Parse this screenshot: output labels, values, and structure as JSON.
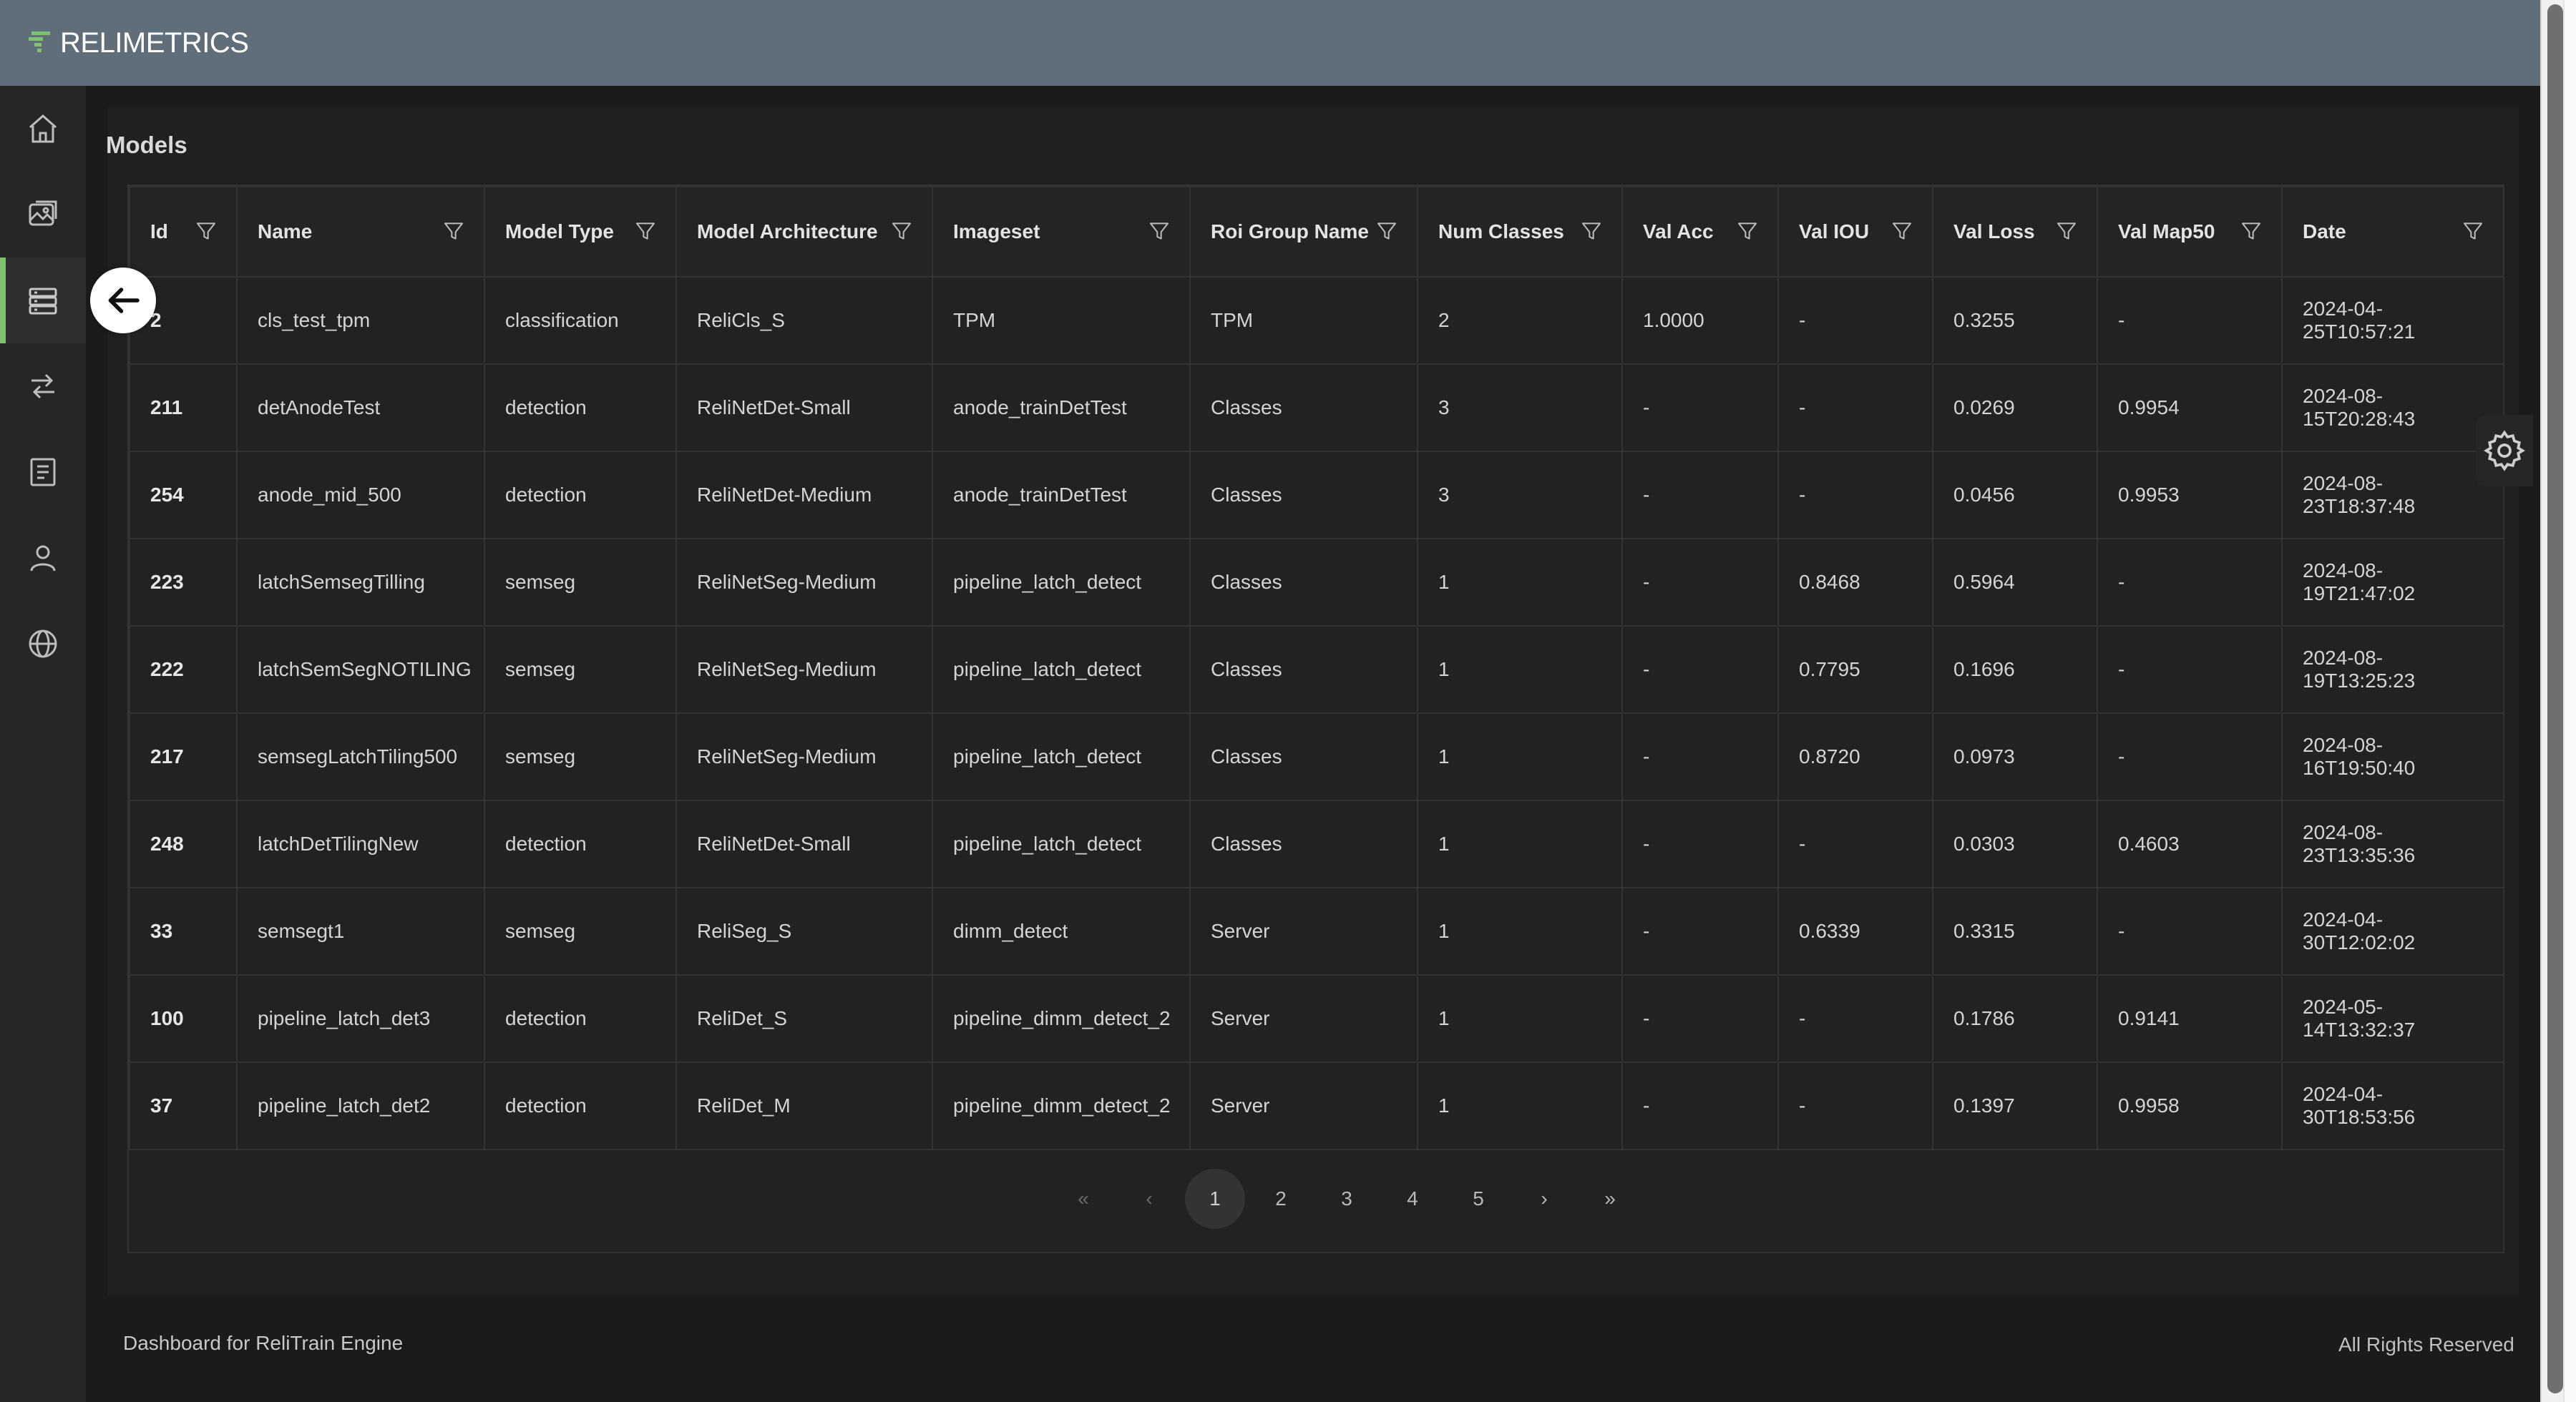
{
  "app": {
    "brand": "RELIMETRICS"
  },
  "page": {
    "title": "Models"
  },
  "nav": [
    {
      "icon": "home-icon"
    },
    {
      "icon": "images-icon"
    },
    {
      "icon": "models-icon"
    },
    {
      "icon": "transfer-icon"
    },
    {
      "icon": "document-icon"
    },
    {
      "icon": "user-icon"
    },
    {
      "icon": "globe-icon"
    }
  ],
  "table": {
    "columns": [
      "Id",
      "Name",
      "Model Type",
      "Model Architecture",
      "Imageset",
      "Roi Group Name",
      "Num Classes",
      "Val Acc",
      "Val IOU",
      "Val Loss",
      "Val Map50",
      "Date"
    ],
    "rows": [
      [
        "2",
        "cls_test_tpm",
        "classification",
        "ReliCls_S",
        "TPM",
        "TPM",
        "2",
        "1.0000",
        "-",
        "0.3255",
        "-",
        "2024-04-25T10:57:21"
      ],
      [
        "211",
        "detAnodeTest",
        "detection",
        "ReliNetDet-Small",
        "anode_trainDetTest",
        "Classes",
        "3",
        "-",
        "-",
        "0.0269",
        "0.9954",
        "2024-08-15T20:28:43"
      ],
      [
        "254",
        "anode_mid_500",
        "detection",
        "ReliNetDet-Medium",
        "anode_trainDetTest",
        "Classes",
        "3",
        "-",
        "-",
        "0.0456",
        "0.9953",
        "2024-08-23T18:37:48"
      ],
      [
        "223",
        "latchSemsegTilling",
        "semseg",
        "ReliNetSeg-Medium",
        "pipeline_latch_detect",
        "Classes",
        "1",
        "-",
        "0.8468",
        "0.5964",
        "-",
        "2024-08-19T21:47:02"
      ],
      [
        "222",
        "latchSemSegNOTILING",
        "semseg",
        "ReliNetSeg-Medium",
        "pipeline_latch_detect",
        "Classes",
        "1",
        "-",
        "0.7795",
        "0.1696",
        "-",
        "2024-08-19T13:25:23"
      ],
      [
        "217",
        "semsegLatchTiling500",
        "semseg",
        "ReliNetSeg-Medium",
        "pipeline_latch_detect",
        "Classes",
        "1",
        "-",
        "0.8720",
        "0.0973",
        "-",
        "2024-08-16T19:50:40"
      ],
      [
        "248",
        "latchDetTilingNew",
        "detection",
        "ReliNetDet-Small",
        "pipeline_latch_detect",
        "Classes",
        "1",
        "-",
        "-",
        "0.0303",
        "0.4603",
        "2024-08-23T13:35:36"
      ],
      [
        "33",
        "semsegt1",
        "semseg",
        "ReliSeg_S",
        "dimm_detect",
        "Server",
        "1",
        "-",
        "0.6339",
        "0.3315",
        "-",
        "2024-04-30T12:02:02"
      ],
      [
        "100",
        "pipeline_latch_det3",
        "detection",
        "ReliDet_S",
        "pipeline_dimm_detect_2",
        "Server",
        "1",
        "-",
        "-",
        "0.1786",
        "0.9141",
        "2024-05-14T13:32:37"
      ],
      [
        "37",
        "pipeline_latch_det2",
        "detection",
        "ReliDet_M",
        "pipeline_dimm_detect_2",
        "Server",
        "1",
        "-",
        "-",
        "0.1397",
        "0.9958",
        "2024-04-30T18:53:56"
      ]
    ]
  },
  "pagination": {
    "first": "«",
    "prev": "‹",
    "next": "›",
    "last": "»",
    "pages": [
      "1",
      "2",
      "3",
      "4",
      "5"
    ],
    "current": "1"
  },
  "footer": {
    "left": "Dashboard for ReliTrain Engine",
    "right": "All Rights Reserved"
  },
  "colors": {
    "accent": "#7cc26f",
    "header": "#5f6e78",
    "background": "#1b1b1b"
  }
}
